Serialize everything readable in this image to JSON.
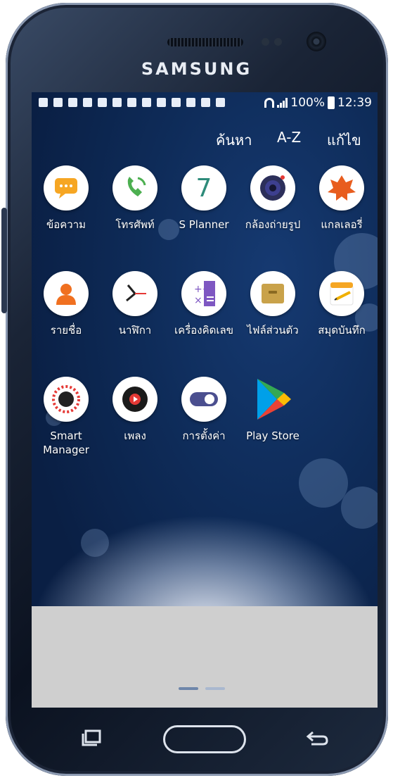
{
  "device": {
    "brand": "SAMSUNG"
  },
  "status_bar": {
    "battery": "100%",
    "time": "12:39",
    "notification_icons": [
      "message-icon",
      "gallery-icon",
      "gallery-icon",
      "person-icon",
      "image-icon",
      "app-icon",
      "app-icon",
      "app-icon",
      "grid-icon",
      "mail-icon",
      "drive-icon",
      "shopping-bag-icon",
      "shopping-bag-icon"
    ]
  },
  "top_menu": {
    "search": "ค้นหา",
    "sort": "A-Z",
    "edit": "แก้ไข"
  },
  "apps": [
    {
      "label": "ข้อความ",
      "icon": "messages-icon",
      "color": "#f6a623"
    },
    {
      "label": "โทรศัพท์",
      "icon": "phone-icon",
      "color": "#4caf50"
    },
    {
      "label": "S Planner",
      "icon": "calendar-icon",
      "color": "#2e8b7a",
      "text": "7"
    },
    {
      "label": "กล้องถ่ายรูป",
      "icon": "camera-icon",
      "color": "#3d3f8f"
    },
    {
      "label": "แกลเลอรี่",
      "icon": "gallery-icon",
      "color": "#e85d1e"
    },
    {
      "label": "รายชื่อ",
      "icon": "contacts-icon",
      "color": "#f07020"
    },
    {
      "label": "นาฬิกา",
      "icon": "clock-icon",
      "color": "#222222"
    },
    {
      "label": "เครื่องคิดเลข",
      "icon": "calculator-icon",
      "color": "#7e57c2"
    },
    {
      "label": "ไฟล์ส่วนตัว",
      "icon": "folder-icon",
      "color": "#c9a24a"
    },
    {
      "label": "สมุดบันทึก",
      "icon": "memo-icon",
      "color": "#f5a623"
    },
    {
      "label": "Smart Manager",
      "icon": "smart-manager-icon",
      "color": "#222222"
    },
    {
      "label": "เพลง",
      "icon": "music-icon",
      "color": "#e53935"
    },
    {
      "label": "การตั้งค่า",
      "icon": "settings-icon",
      "color": "#4b4f8f"
    },
    {
      "label": "Play Store",
      "icon": "play-store-icon",
      "color": "#00a0e9"
    }
  ],
  "page_indicator": {
    "pages": 2,
    "current": 1
  },
  "colors": {
    "screen_bg": "#0e2b58",
    "snow": "#cfcfcf",
    "indicator_active": "#6e86aa",
    "indicator_inactive": "#a9b8cf"
  }
}
